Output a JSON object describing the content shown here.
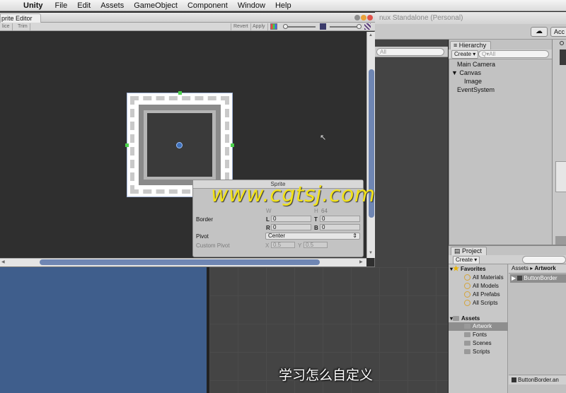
{
  "menubar": {
    "apple_glyph": "",
    "app_name": "Unity",
    "items": [
      "File",
      "Edit",
      "Assets",
      "GameObject",
      "Component",
      "Window",
      "Help"
    ]
  },
  "unity_window": {
    "title_fragment": "nux Standalone (Personal)",
    "cloud_glyph": "☁",
    "account_label": "Acc"
  },
  "scene": {
    "search_placeholder": "All"
  },
  "sprite_editor": {
    "tab_label": "prite Editor",
    "toolbar": {
      "slice": "lice",
      "trim": "Trim",
      "revert": "Revert",
      "apply": "Apply"
    },
    "panel": {
      "title": "Sprite",
      "width_label": "W",
      "width_value": "64",
      "height_label": "H",
      "height_value": "64",
      "border_label": "Border",
      "border_l_label": "L",
      "border_l": "0",
      "border_t_label": "T",
      "border_t": "0",
      "border_r_label": "R",
      "border_r": "0",
      "border_b_label": "B",
      "border_b": "0",
      "pivot_label": "Pivot",
      "pivot_value": "Center",
      "custom_pivot_label": "Custom Pivot",
      "custom_x_label": "X",
      "custom_x": "0.5",
      "custom_y_label": "Y",
      "custom_y": "0.5"
    }
  },
  "hierarchy": {
    "tab_label": "Hierarchy",
    "create_label": "Create",
    "search_placeholder": "Q▾All",
    "items": [
      {
        "label": "Main Camera"
      },
      {
        "label": "Canvas"
      },
      {
        "label": "Image"
      },
      {
        "label": "EventSystem"
      }
    ]
  },
  "project": {
    "tab_label": "Project",
    "create_label": "Create",
    "favorites_label": "Favorites",
    "favorites": [
      "All Materials",
      "All Models",
      "All Prefabs",
      "All Scripts"
    ],
    "assets_label": "Assets",
    "folders": [
      "Artwork",
      "Fonts",
      "Scenes",
      "Scripts"
    ],
    "breadcrumb_root": "Assets",
    "breadcrumb_current": "Artwork",
    "asset_item": "ButtonBorder",
    "status_file": "ButtonBorder.an"
  },
  "overlay": {
    "watermark": "www.cgtsj.com",
    "subtitle": "学习怎么自定义"
  }
}
